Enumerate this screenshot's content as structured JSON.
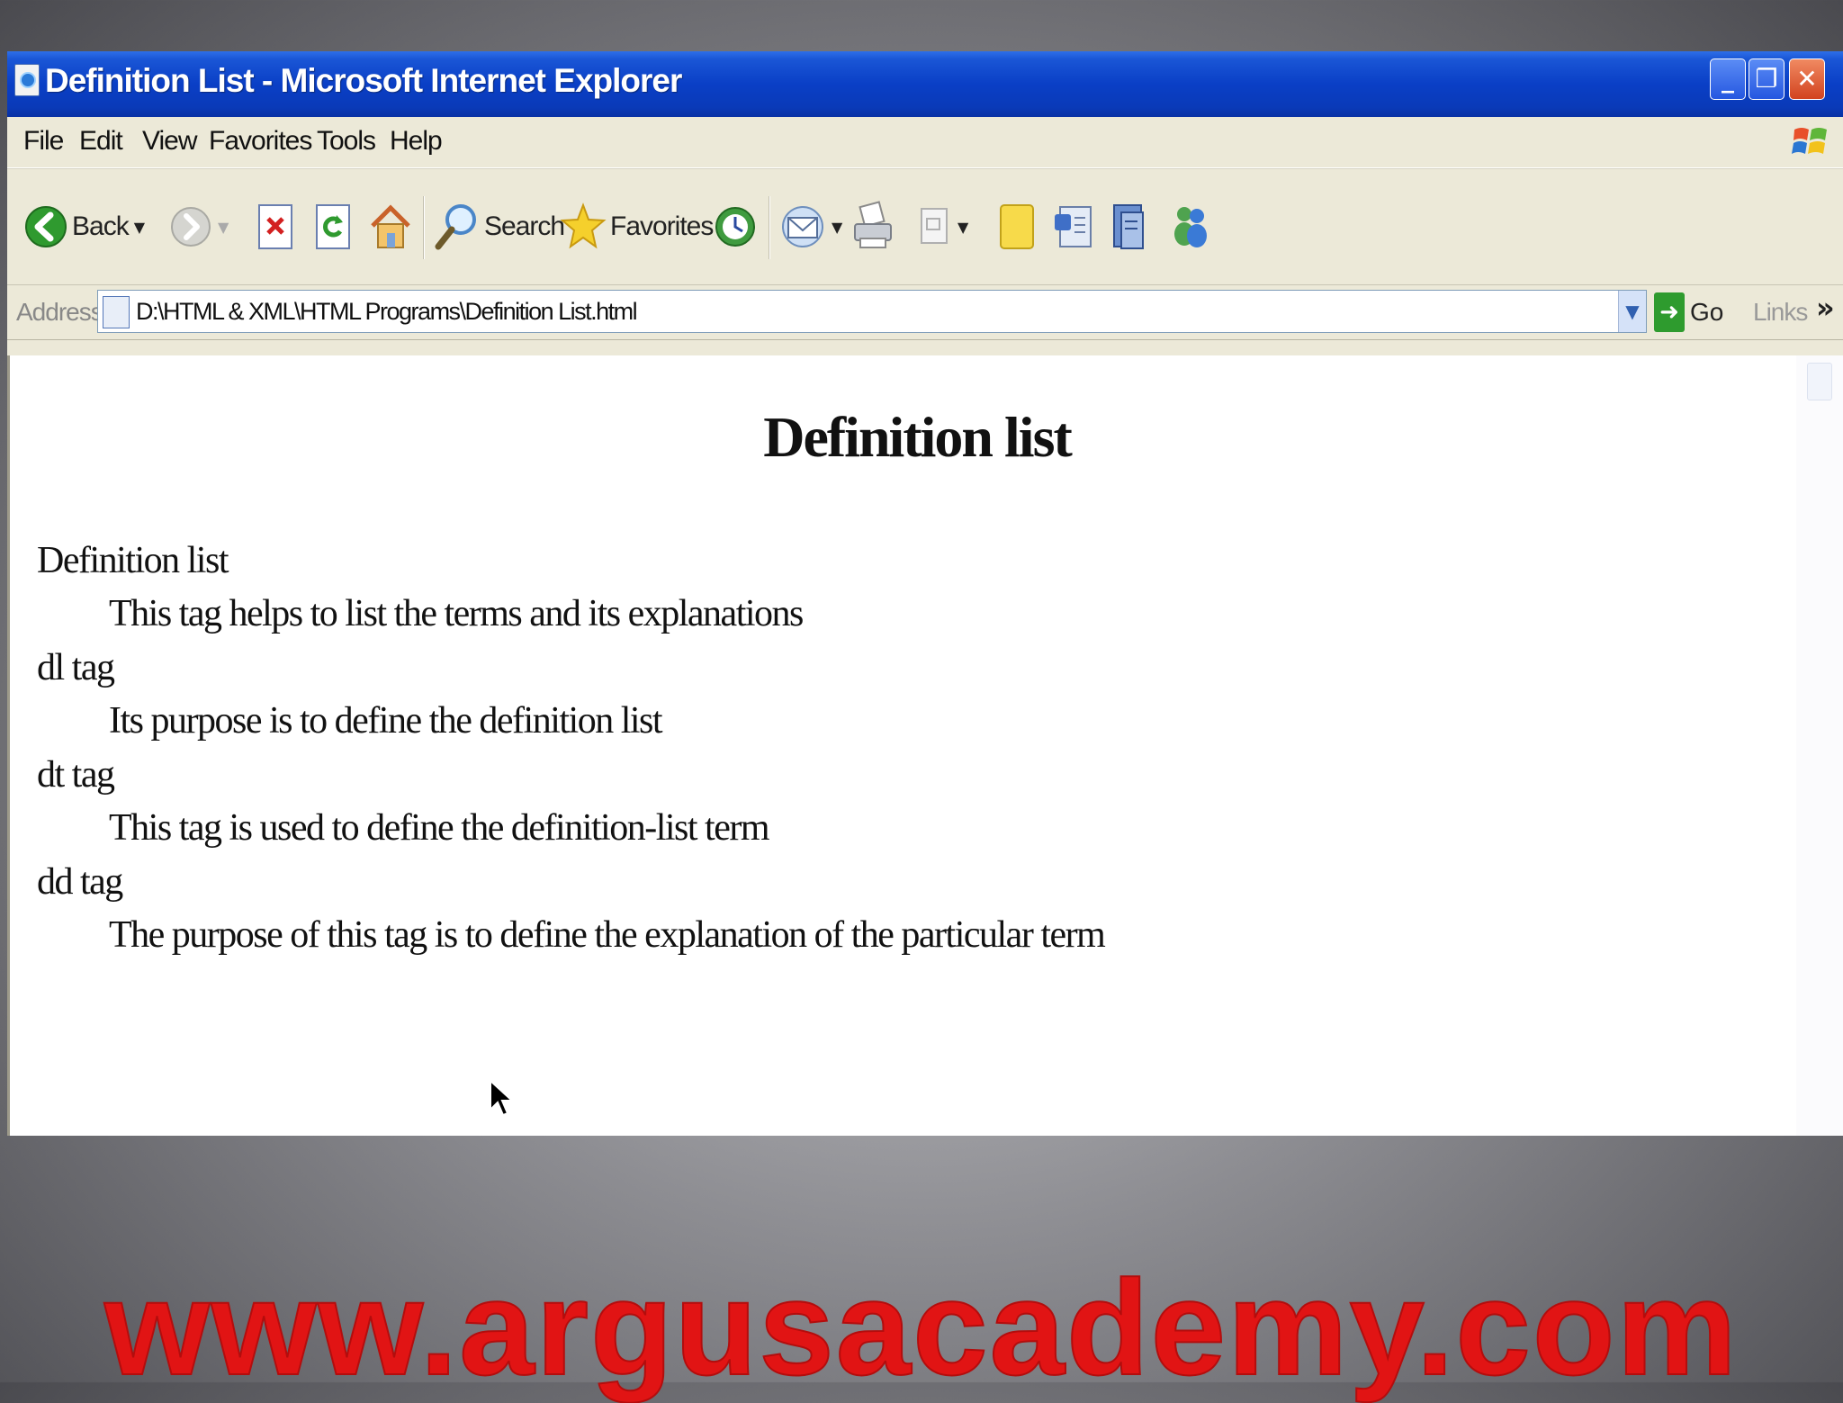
{
  "window": {
    "title": "Definition List - Microsoft Internet Explorer",
    "controls": {
      "minimize": "_",
      "maximize": "❐",
      "close": "✕"
    }
  },
  "menu": [
    "File",
    "Edit",
    "View",
    "Favorites",
    "Tools",
    "Help"
  ],
  "toolbar": {
    "back_label": "Back",
    "search_label": "Search",
    "favorites_label": "Favorites",
    "icons": [
      "back-icon",
      "forward-icon",
      "stop-icon",
      "refresh-icon",
      "home-icon",
      "search-icon",
      "favorites-star-icon",
      "history-icon",
      "mail-icon",
      "print-icon",
      "edit-icon",
      "notes-icon",
      "messenger-icon",
      "research-icon",
      "msn-icon"
    ]
  },
  "address": {
    "label": "Address",
    "url": "D:\\HTML & XML\\HTML Programs\\Definition List.html",
    "go_label": "Go",
    "links_label": "Links",
    "more": "»"
  },
  "page": {
    "heading": "Definition list",
    "definitions": [
      {
        "term": "Definition list",
        "description": "This tag helps to list the terms and its explanations"
      },
      {
        "term": "dl tag",
        "description": "Its purpose is to define the definition list"
      },
      {
        "term": "dt tag",
        "description": "This tag is used to define the definition-list term"
      },
      {
        "term": "dd tag",
        "description": "The purpose of this tag is to define the explanation of the particular term"
      }
    ]
  },
  "watermark": "www.argusacademy.com",
  "colors": {
    "titlebar": "#0a3fc6",
    "chrome": "#ece9d8",
    "watermark": "#e11414"
  }
}
